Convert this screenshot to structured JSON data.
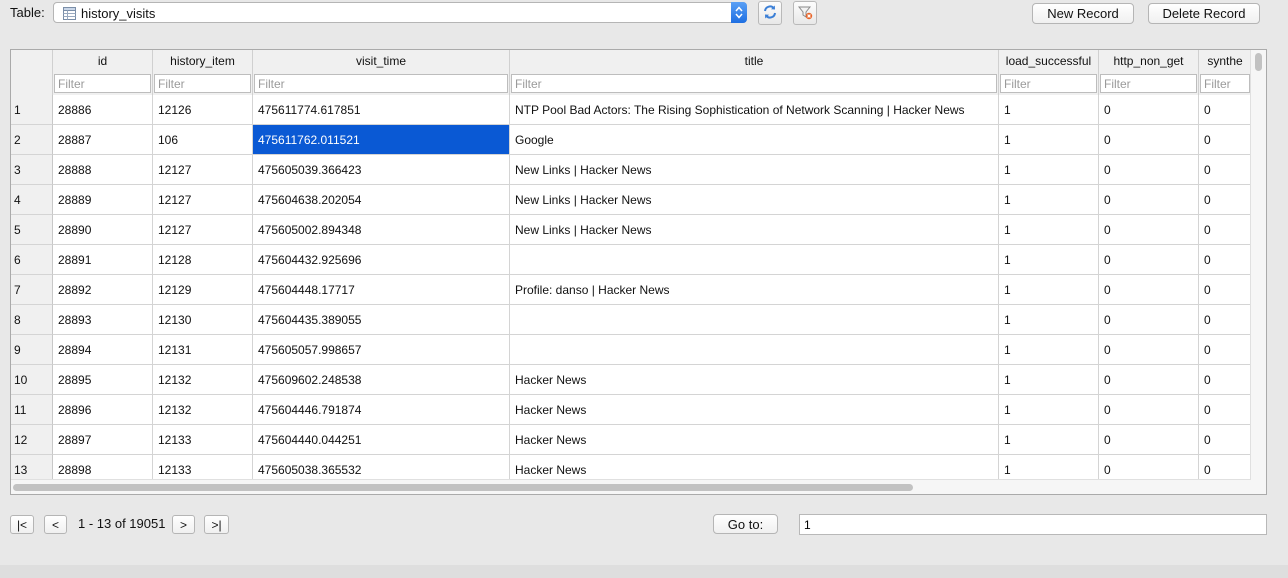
{
  "toolbar": {
    "table_label": "Table:",
    "table_name": "history_visits",
    "new_record": "New Record",
    "delete_record": "Delete Record"
  },
  "grid": {
    "columns": [
      "id",
      "history_item",
      "visit_time",
      "title",
      "load_successful",
      "http_non_get",
      "synthe"
    ],
    "filter_placeholder": "Filter",
    "selected_cell": {
      "row": 2,
      "column": "visit_time"
    },
    "rows": [
      {
        "n": "1",
        "id": "28886",
        "history_item": "12126",
        "visit_time": "475611774.617851",
        "title": "NTP Pool Bad Actors: The Rising Sophistication of Network Scanning | Hacker News",
        "load_successful": "1",
        "http_non_get": "0",
        "synthe": "0"
      },
      {
        "n": "2",
        "id": "28887",
        "history_item": "106",
        "visit_time": "475611762.011521",
        "title": "Google",
        "load_successful": "1",
        "http_non_get": "0",
        "synthe": "0"
      },
      {
        "n": "3",
        "id": "28888",
        "history_item": "12127",
        "visit_time": "475605039.366423",
        "title": "New Links | Hacker News",
        "load_successful": "1",
        "http_non_get": "0",
        "synthe": "0"
      },
      {
        "n": "4",
        "id": "28889",
        "history_item": "12127",
        "visit_time": "475604638.202054",
        "title": "New Links | Hacker News",
        "load_successful": "1",
        "http_non_get": "0",
        "synthe": "0"
      },
      {
        "n": "5",
        "id": "28890",
        "history_item": "12127",
        "visit_time": "475605002.894348",
        "title": "New Links | Hacker News",
        "load_successful": "1",
        "http_non_get": "0",
        "synthe": "0"
      },
      {
        "n": "6",
        "id": "28891",
        "history_item": "12128",
        "visit_time": "475604432.925696",
        "title": "",
        "load_successful": "1",
        "http_non_get": "0",
        "synthe": "0"
      },
      {
        "n": "7",
        "id": "28892",
        "history_item": "12129",
        "visit_time": "475604448.17717",
        "title": "Profile: danso | Hacker News",
        "load_successful": "1",
        "http_non_get": "0",
        "synthe": "0"
      },
      {
        "n": "8",
        "id": "28893",
        "history_item": "12130",
        "visit_time": "475604435.389055",
        "title": "",
        "load_successful": "1",
        "http_non_get": "0",
        "synthe": "0"
      },
      {
        "n": "9",
        "id": "28894",
        "history_item": "12131",
        "visit_time": "475605057.998657",
        "title": "",
        "load_successful": "1",
        "http_non_get": "0",
        "synthe": "0"
      },
      {
        "n": "10",
        "id": "28895",
        "history_item": "12132",
        "visit_time": "475609602.248538",
        "title": "Hacker News",
        "load_successful": "1",
        "http_non_get": "0",
        "synthe": "0"
      },
      {
        "n": "11",
        "id": "28896",
        "history_item": "12132",
        "visit_time": "475604446.791874",
        "title": "Hacker News",
        "load_successful": "1",
        "http_non_get": "0",
        "synthe": "0"
      },
      {
        "n": "12",
        "id": "28897",
        "history_item": "12133",
        "visit_time": "475604440.044251",
        "title": "Hacker News",
        "load_successful": "1",
        "http_non_get": "0",
        "synthe": "0"
      },
      {
        "n": "13",
        "id": "28898",
        "history_item": "12133",
        "visit_time": "475605038.365532",
        "title": "Hacker News",
        "load_successful": "1",
        "http_non_get": "0",
        "synthe": "0"
      }
    ]
  },
  "navigation": {
    "first": "|<",
    "prev": "<",
    "next": ">",
    "last": ">|",
    "page_info": "1 - 13 of 19051",
    "goto_label": "Go to:",
    "goto_value": "1"
  },
  "colors": {
    "selection": "#0a59d4",
    "dropdown_accent": "#1e6fe2"
  },
  "icons": [
    "table-icon",
    "dropdown-arrows-icon",
    "refresh-icon",
    "clear-filters-icon"
  ]
}
